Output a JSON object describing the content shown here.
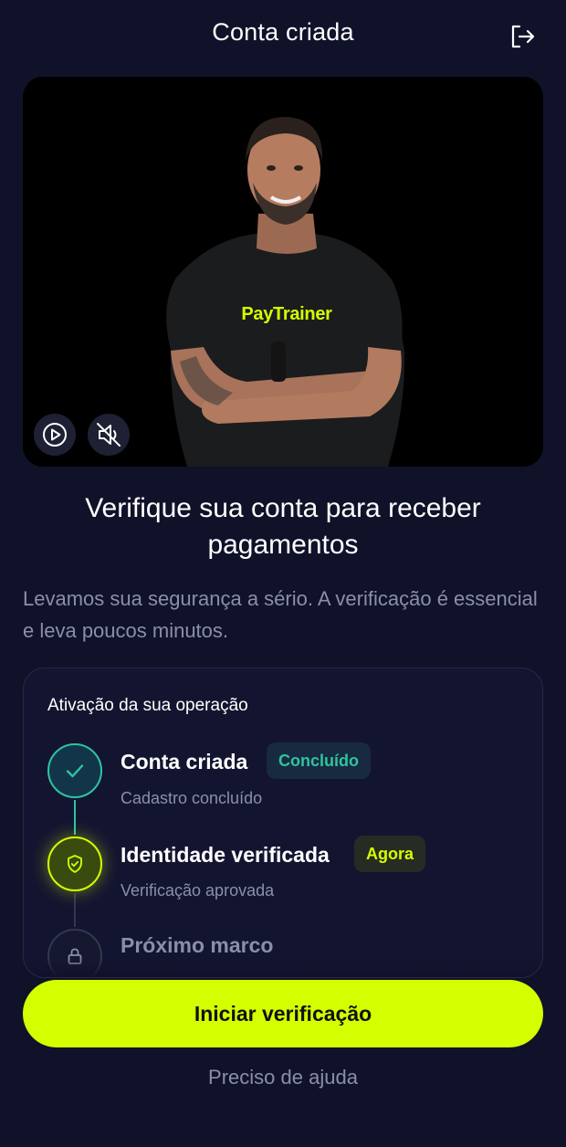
{
  "header": {
    "title": "Conta criada",
    "logout_icon": "logout-icon"
  },
  "video": {
    "brand": "PayTrainer",
    "play_icon": "play-icon",
    "mute_icon": "mute-icon"
  },
  "headline": "Verifique sua conta para receber pagamentos",
  "subtext": "Levamos sua segurança a sério. A verificação é essencial e leva poucos minutos.",
  "progress": {
    "title": "Ativação da sua operação",
    "steps": [
      {
        "title": "Conta criada",
        "badge": "Concluído",
        "subtitle": "Cadastro concluído",
        "status": "done",
        "icon": "check-icon"
      },
      {
        "title": "Identidade verificada",
        "badge": "Agora",
        "subtitle": "Verificação aprovada",
        "status": "current",
        "icon": "shield-check-icon"
      },
      {
        "title": "Próximo marco",
        "status": "locked",
        "icon": "lock-icon"
      }
    ]
  },
  "cta": {
    "label": "Iniciar verificação"
  },
  "help": {
    "label": "Preciso de ajuda"
  },
  "colors": {
    "background": "#10122a",
    "accent": "#d4ff00",
    "success": "#2ec4a0",
    "muted_text": "#8b8fa6"
  }
}
